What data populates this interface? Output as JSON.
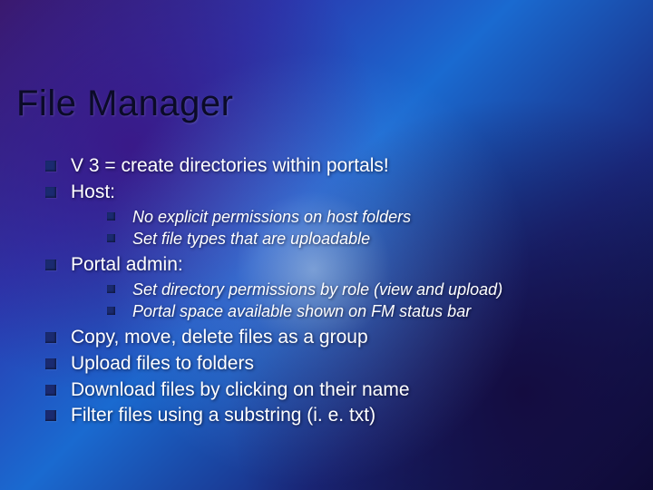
{
  "title": "File Manager",
  "bullets": {
    "b0": "V 3 = create directories within portals!",
    "b1": "Host:",
    "b1_sub": {
      "s0": "No explicit permissions on host folders",
      "s1": "Set file types that are uploadable"
    },
    "b2": "Portal admin:",
    "b2_sub": {
      "s0": "Set directory permissions by role (view and upload)",
      "s1": "Portal space available shown on FM status bar"
    },
    "b3": "Copy, move, delete files as a group",
    "b4": "Upload files to folders",
    "b5": "Download files by clicking on their name",
    "b6": "Filter files using a substring (i. e. txt)"
  }
}
